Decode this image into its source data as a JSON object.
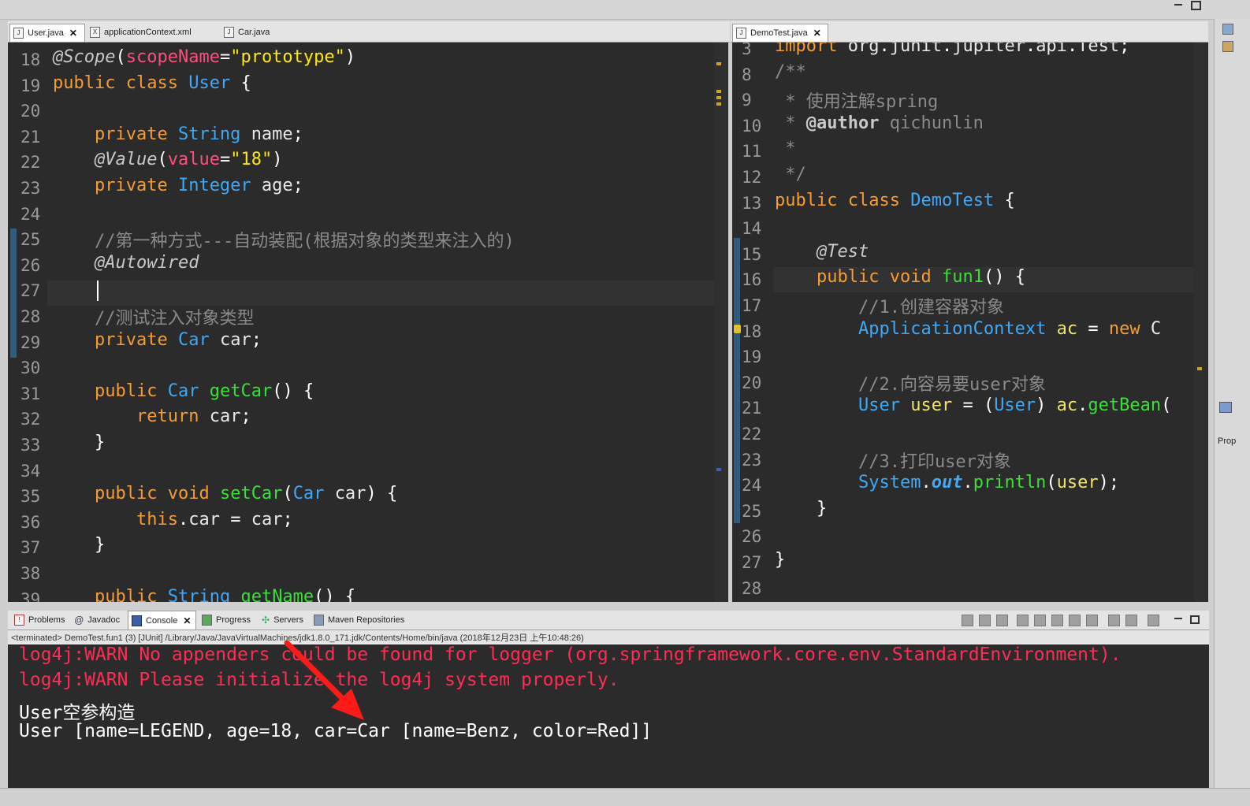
{
  "left_editor": {
    "tabs": [
      {
        "label": "User.java",
        "icon": "java-file-icon",
        "active": true
      },
      {
        "label": "applicationContext.xml",
        "icon": "xml-file-icon",
        "active": false
      },
      {
        "label": "Car.java",
        "icon": "java-file-icon",
        "active": false
      }
    ],
    "line_numbers": [
      "18",
      "19",
      "20",
      "21",
      "22",
      "23",
      "24",
      "25",
      "26",
      "27",
      "28",
      "29",
      "30",
      "31",
      "32",
      "33",
      "34",
      "35",
      "36",
      "37",
      "38",
      "39"
    ],
    "lines": [
      "@Scope(scopeName=\"prototype\")",
      "public class User {",
      "",
      "    private String name;",
      "    @Value(value=\"18\")",
      "    private Integer age;",
      "",
      "    //第一种方式---自动装配(根据对象的类型来注入的)",
      "    @Autowired",
      "",
      "    //测试注入对象类型",
      "    private Car car;",
      "",
      "    public Car getCar() {",
      "        return car;",
      "    }",
      "",
      "    public void setCar(Car car) {",
      "        this.car = car;",
      "    }",
      "",
      "    public String getName() {"
    ]
  },
  "right_editor": {
    "tabs": [
      {
        "label": "DemoTest.java",
        "icon": "java-file-icon",
        "active": true
      }
    ],
    "line_numbers": [
      "3",
      "8",
      "9",
      "10",
      "11",
      "12",
      "13",
      "14",
      "15",
      "16",
      "17",
      "18",
      "19",
      "20",
      "21",
      "22",
      "23",
      "24",
      "25",
      "26",
      "27",
      "28"
    ],
    "lines": [
      "import org.junit.jupiter.api.Test;",
      "/**",
      " * 使用注解spring",
      " * @author qichunlin",
      " *",
      " */",
      "public class DemoTest {",
      "",
      "    @Test",
      "    public void fun1() {",
      "        //1.创建容器对象",
      "        ApplicationContext ac = new C",
      "",
      "        //2.向容易要user对象",
      "        User user = (User) ac.getBean(",
      "",
      "        //3.打印user对象",
      "        System.out.println(user);",
      "    }",
      "",
      "}",
      ""
    ]
  },
  "bottom_panel": {
    "tabs": [
      {
        "label": "Problems",
        "icon": "problems-icon",
        "active": false
      },
      {
        "label": "Javadoc",
        "icon": "javadoc-icon",
        "active": false
      },
      {
        "label": "Console",
        "icon": "console-icon",
        "active": true
      },
      {
        "label": "Progress",
        "icon": "progress-icon",
        "active": false
      },
      {
        "label": "Servers",
        "icon": "servers-icon",
        "active": false
      },
      {
        "label": "Maven Repositories",
        "icon": "maven-icon",
        "active": false
      }
    ],
    "status": "<terminated> DemoTest.fun1 (3) [JUnit] /Library/Java/JavaVirtualMachines/jdk1.8.0_171.jdk/Contents/Home/bin/java (2018年12月23日 上午10:48:26)",
    "console_lines": [
      {
        "text": "log4j:WARN No appenders could be found for logger (org.springframework.core.env.StandardEnvironment).",
        "color": "#ff2d55"
      },
      {
        "text": "log4j:WARN Please initialize the log4j system properly.",
        "color": "#ff2d55"
      },
      {
        "text": "User空参构造",
        "color": "#ffffff"
      },
      {
        "text": "User [name=LEGEND, age=18, car=Car [name=Benz, color=Red]]",
        "color": "#ffffff"
      }
    ]
  },
  "side_panel": {
    "label": "Prop"
  },
  "colors": {
    "editor_bg": "#2b2b2b",
    "keyword": "#f59d32",
    "type": "#3fa9f5",
    "method": "#39e037",
    "string": "#ffeb00",
    "warn": "#ff2d55",
    "arrow": "#ff1a1a"
  }
}
